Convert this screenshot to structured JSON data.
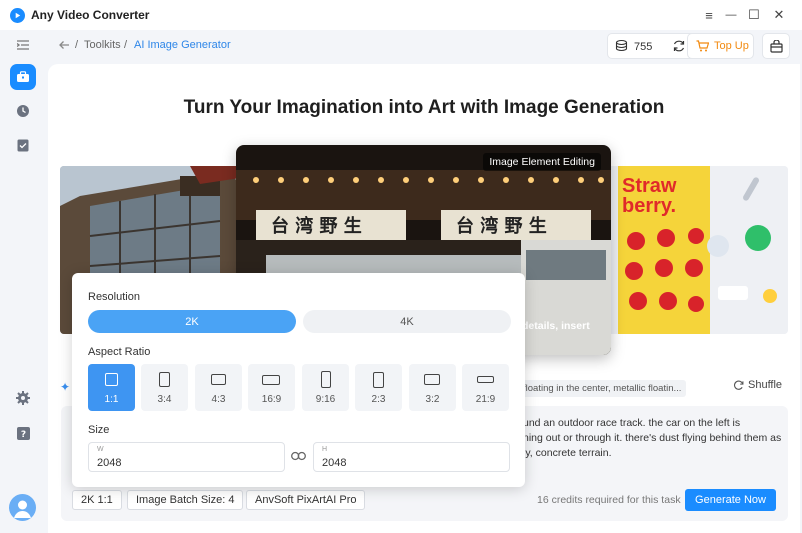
{
  "app": {
    "title": "Any Video Converter"
  },
  "window_controls": {
    "menu": "≡",
    "minimize": "—",
    "maximize": "☐",
    "close": "✕"
  },
  "breadcrumb": {
    "separator": "/",
    "items": [
      "Toolkits",
      "AI Image Generator"
    ]
  },
  "header": {
    "credits": "755",
    "topup_label": "Top Up"
  },
  "main": {
    "headline": "Turn Your Imagination into Art with Image Generation",
    "image_badge": "Image Element Editing",
    "overlay_text": "details, insert",
    "poster_text": "Straw berry."
  },
  "settings": {
    "resolution_label": "Resolution",
    "resolution_options": [
      "2K",
      "4K"
    ],
    "resolution_selected": "2K",
    "aspect_label": "Aspect Ratio",
    "aspect_options": [
      "1:1",
      "3:4",
      "4:3",
      "16:9",
      "9:16",
      "2:3",
      "3:2",
      "21:9"
    ],
    "aspect_selected": "1:1",
    "size_label": "Size",
    "width_label": "W",
    "width_value": "2048",
    "height_label": "H",
    "height_value": "2048"
  },
  "prompt": {
    "chip": "floating in the center, metallic floatin...",
    "shuffle_label": "Shuffle",
    "text_lines": [
      "und an outdoor race track. the car on the left is",
      "ning out or through it. there's dust flying behind them as",
      "ly, concrete terrain."
    ]
  },
  "footer": {
    "chips": [
      "2K 1:1",
      "Image Batch Size: 4",
      "AnvSoft PixArtAI Pro"
    ],
    "credits_required": "16 credits required for this task",
    "generate_label": "Generate Now"
  },
  "colors": {
    "accent": "#1a8cff",
    "topup": "#f28a10"
  }
}
